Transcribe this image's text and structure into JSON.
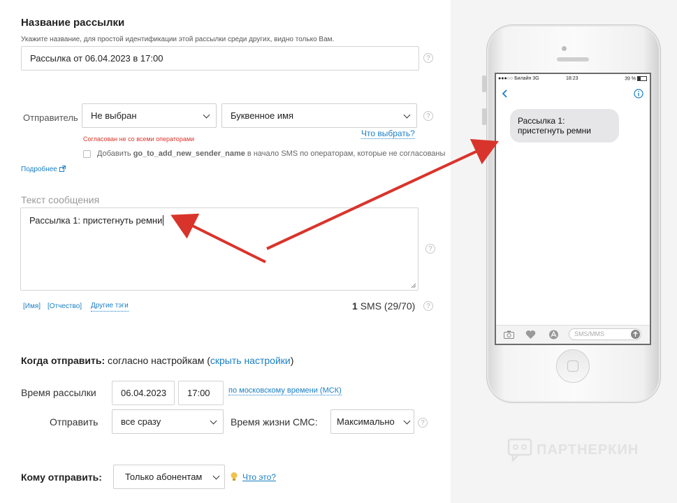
{
  "name_section": {
    "title": "Название рассылки",
    "hint": "Укажите название, для простой идентификации этой рассылки среди других, видно только Вам.",
    "value": "Рассылка от 06.04.2023 в 17:00"
  },
  "sender": {
    "label": "Отправитель",
    "select1": "Не выбран",
    "select2": "Буквенное имя",
    "warning": "Согласован не со всеми операторами",
    "what_to_choose": "Что выбрать?",
    "checkbox_prefix": "Добавить",
    "checkbox_bold": "go_to_add_new_sender_name",
    "checkbox_suffix": "в начало SMS по операторам, которые не согласованы",
    "more_link": "Подробнее"
  },
  "message": {
    "label": "Текст сообщения",
    "text": "Рассылка 1: пристегнуть ремни",
    "tag_name": "[Имя]",
    "tag_patronymic": "[Отчество]",
    "other_tags": "Другие тэги",
    "sms_count": "1",
    "sms_info": "SMS (29/70)"
  },
  "when": {
    "label": "Когда отправить:",
    "text": "согласно настройкам (",
    "hide_link": "скрыть настройки",
    "close_paren": ")",
    "time_label": "Время рассылки",
    "date": "06.04.2023",
    "time": "17:00",
    "tz_link": "по московскому времени (МСК)",
    "send_label": "Отправить",
    "send_value": "все сразу",
    "ttl_label": "Время жизни СМС:",
    "ttl_value": "Максимально"
  },
  "recipients": {
    "label": "Кому отправить:",
    "value": "Только абонентам",
    "what_link": "Что это?"
  },
  "phone": {
    "carrier": "●●●○○ Билайн  3G",
    "time": "18:23",
    "battery": "39 %",
    "bubble": "Рассылка 1: пристегнуть ремни",
    "input_placeholder": "SMS/MMS"
  },
  "watermark": "ПАРТНЕРКИН",
  "colors": {
    "link": "#1a7fc4",
    "warning": "#d9342b",
    "arrow": "#d9342b"
  }
}
